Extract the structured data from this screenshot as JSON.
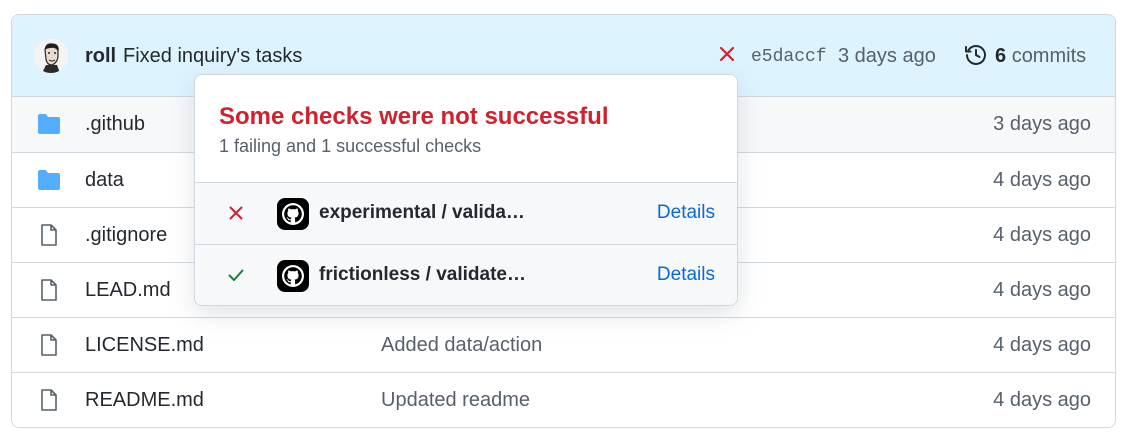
{
  "commit": {
    "author": "roll",
    "message": "Fixed inquiry's tasks",
    "sha": "e5daccf",
    "time_ago": "3 days ago",
    "commit_count": "6",
    "commits_label": "commits",
    "status": "failed"
  },
  "files": [
    {
      "name": ".github",
      "type": "folder",
      "message": "",
      "age": "3 days ago"
    },
    {
      "name": "data",
      "type": "folder",
      "message": "",
      "age": "4 days ago"
    },
    {
      "name": ".gitignore",
      "type": "file",
      "message": "",
      "age": "4 days ago"
    },
    {
      "name": "LEAD.md",
      "type": "file",
      "message": "",
      "age": "4 days ago"
    },
    {
      "name": "LICENSE.md",
      "type": "file",
      "message": "Added data/action",
      "age": "4 days ago"
    },
    {
      "name": "README.md",
      "type": "file",
      "message": "Updated readme",
      "age": "4 days ago"
    }
  ],
  "checks_popover": {
    "title": "Some checks were not successful",
    "subtitle": "1 failing and 1 successful checks",
    "checks": [
      {
        "name": "experimental / valida…",
        "status": "failure",
        "details_label": "Details"
      },
      {
        "name": "frictionless / validate…",
        "status": "success",
        "details_label": "Details"
      }
    ]
  },
  "colors": {
    "failure": "#cf222e",
    "success": "#1a7f37",
    "folder": "#54aeff",
    "link": "#0969da",
    "header_bg": "#ddf4ff"
  },
  "icons": {
    "folder": "folder-icon",
    "file": "file-icon",
    "history": "history-icon",
    "failure": "x-icon",
    "success": "check-icon",
    "app": "github-logo-icon"
  }
}
